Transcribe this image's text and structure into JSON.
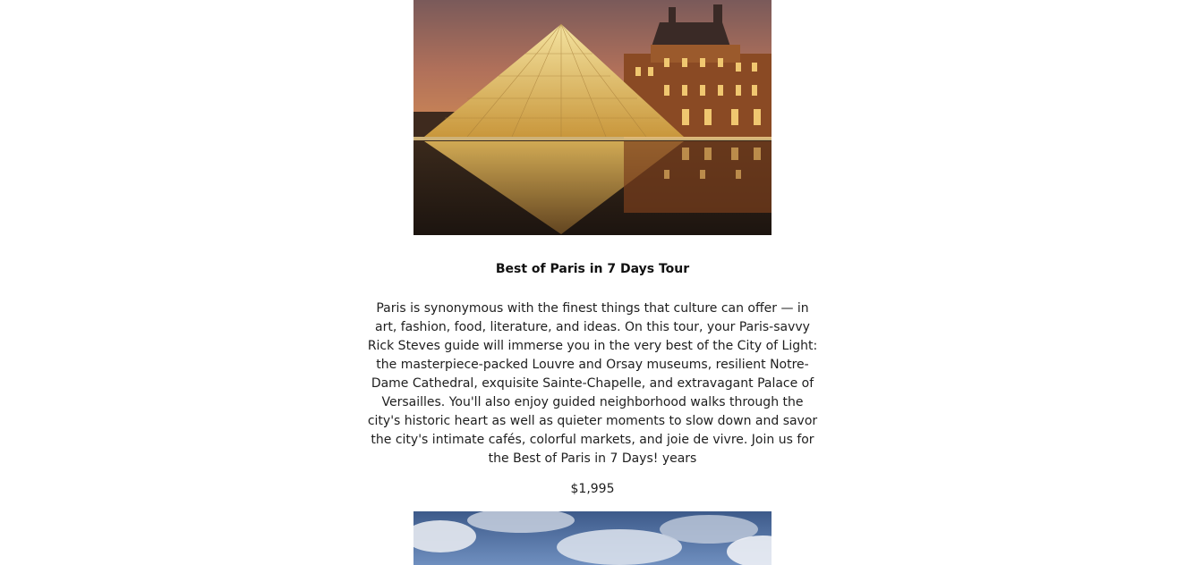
{
  "tours": [
    {
      "image_subject": "louvre-pyramid-photo",
      "title": "Best of Paris in 7 Days Tour",
      "description": "Paris is synonymous with the finest things that culture can offer — in art, fashion, food, literature, and ideas. On this tour, your Paris-savvy Rick Steves guide will immerse you in the very best of the City of Light: the masterpiece-packed Louvre and Orsay museums, resilient Notre-Dame Cathedral, exquisite Sainte-Chapelle, and extravagant Palace of Versailles. You'll also enjoy guided neighborhood walks through the city's historic heart as well as quieter moments to slow down and savor the city's intimate cafés, colorful markets, and joie de vivre. Join us for the Best of Paris in 7 Days! years",
      "price": "$1,995"
    },
    {
      "image_subject": "sky-clouds-photo"
    }
  ],
  "colors": {
    "page_background": "#ffffff",
    "text": "#111111"
  }
}
